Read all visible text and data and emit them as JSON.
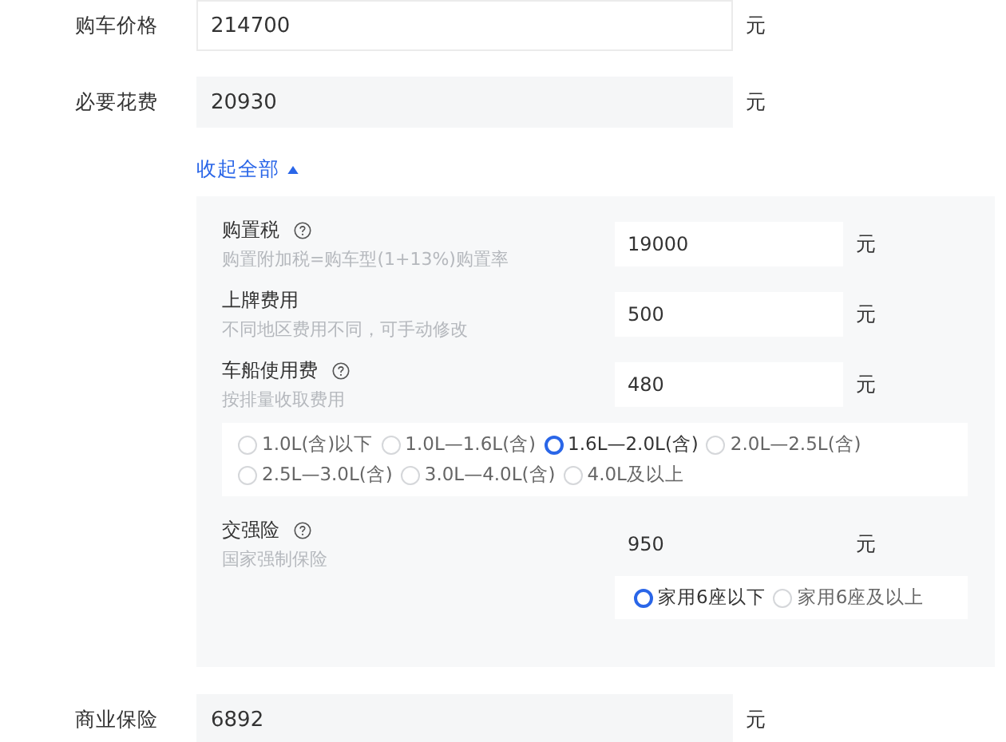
{
  "top_rows": [
    {
      "label": "购车价格",
      "value": "214700",
      "editable": true,
      "unit": "元"
    },
    {
      "label": "必要花费",
      "value": "20930",
      "editable": false,
      "unit": "元"
    }
  ],
  "toggle": {
    "label": "收起全部",
    "expanded": true
  },
  "details": [
    {
      "label": "购置税",
      "help": true,
      "hint": "购置附加税=购车型(1+13%)购置率",
      "value": "19000",
      "editable": true,
      "unit": "元"
    },
    {
      "label": "上牌费用",
      "help": false,
      "hint": "不同地区费用不同，可手动修改",
      "value": "500",
      "editable": true,
      "unit": "元"
    },
    {
      "label": "车船使用费",
      "help": true,
      "hint": "按排量收取费用",
      "value": "480",
      "editable": true,
      "unit": "元",
      "options_wide": true,
      "options": [
        {
          "label": "1.0L(含)以下",
          "selected": false
        },
        {
          "label": "1.0L—1.6L(含)",
          "selected": false
        },
        {
          "label": "1.6L—2.0L(含)",
          "selected": true
        },
        {
          "label": "2.0L—2.5L(含)",
          "selected": false
        },
        {
          "label": "2.5L—3.0L(含)",
          "selected": false
        },
        {
          "label": "3.0L—4.0L(含)",
          "selected": false
        },
        {
          "label": "4.0L及以上",
          "selected": false
        }
      ]
    },
    {
      "label": "交强险",
      "help": true,
      "hint": "国家强制保险",
      "value": "950",
      "editable": false,
      "unit": "元",
      "options_wide": false,
      "options": [
        {
          "label": "家用6座以下",
          "selected": true
        },
        {
          "label": "家用6座及以上",
          "selected": false
        }
      ]
    }
  ],
  "bottom_rows": [
    {
      "label": "商业保险",
      "value": "6892",
      "editable": false,
      "unit": "元"
    }
  ]
}
